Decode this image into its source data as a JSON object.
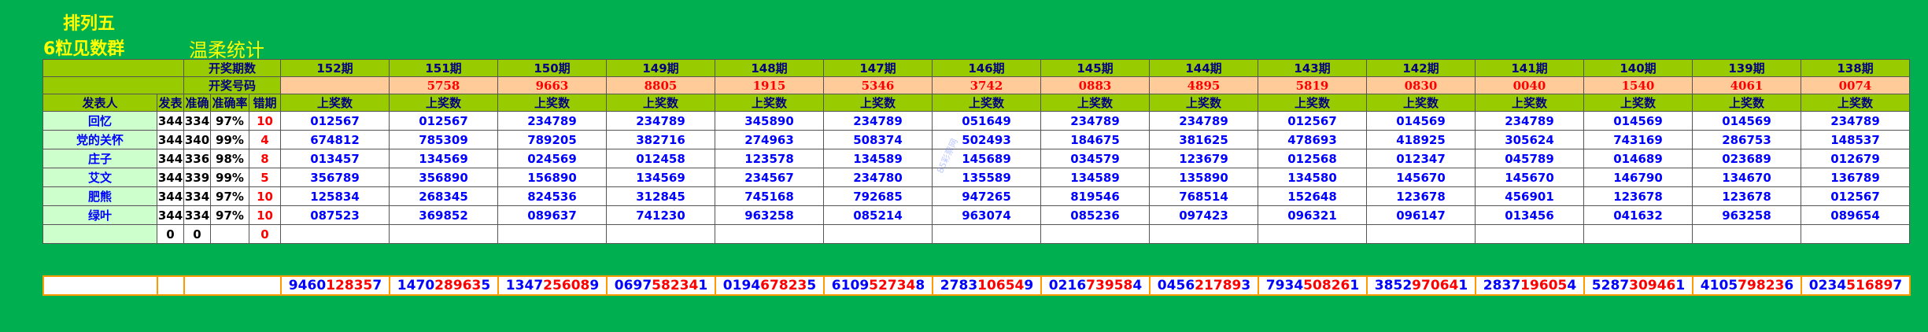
{
  "title1": "排列五",
  "title2": "6粒见数群",
  "title3": "温柔统计",
  "header": {
    "kj_qishu": "开奖期数",
    "kj_haoma": "开奖号码",
    "col_publisher": "发表人",
    "col_fa": "发表",
    "col_zhun": "准确",
    "col_rate": "准确率",
    "col_err": "错期",
    "sub_label": "上奖数"
  },
  "periods": [
    "152期",
    "151期",
    "150期",
    "149期",
    "148期",
    "147期",
    "146期",
    "145期",
    "144期",
    "143期",
    "142期",
    "141期",
    "140期",
    "139期",
    "138期"
  ],
  "draw_numbers": [
    "",
    "5758",
    "9663",
    "8805",
    "1915",
    "5346",
    "3742",
    "0883",
    "4895",
    "5819",
    "0830",
    "0040",
    "1540",
    "4061",
    "0074"
  ],
  "rows": [
    {
      "name": "回忆",
      "fa": "344",
      "zhun": "334",
      "rate": "97%",
      "err": "10",
      "nums": [
        "012567",
        "012567",
        "234789",
        "234789",
        "345890",
        "234789",
        "051649",
        "234789",
        "234789",
        "012567",
        "014569",
        "234789",
        "014569",
        "014569",
        "234789"
      ]
    },
    {
      "name": "党的关怀",
      "fa": "344",
      "zhun": "340",
      "rate": "99%",
      "err": "4",
      "nums": [
        "674812",
        "785309",
        "789205",
        "382716",
        "274963",
        "508374",
        "502493",
        "184675",
        "381625",
        "478693",
        "418925",
        "305624",
        "743169",
        "286753",
        "148537"
      ]
    },
    {
      "name": "庄子",
      "fa": "344",
      "zhun": "336",
      "rate": "98%",
      "err": "8",
      "nums": [
        "013457",
        "134569",
        "024569",
        "012458",
        "123578",
        "134589",
        "145689",
        "034579",
        "123679",
        "012568",
        "012347",
        "045789",
        "014689",
        "023689",
        "012679"
      ]
    },
    {
      "name": "艾文",
      "fa": "344",
      "zhun": "339",
      "rate": "99%",
      "err": "5",
      "nums": [
        "356789",
        "356890",
        "156890",
        "134569",
        "234567",
        "234780",
        "135589",
        "134589",
        "135890",
        "134580",
        "145670",
        "145670",
        "146790",
        "134670",
        "136789"
      ]
    },
    {
      "name": "肥熊",
      "fa": "344",
      "zhun": "334",
      "rate": "97%",
      "err": "10",
      "nums": [
        "125834",
        "268345",
        "824536",
        "312845",
        "745168",
        "792685",
        "947265",
        "819546",
        "768514",
        "152648",
        "123678",
        "456901",
        "123678",
        "123678",
        "012567"
      ]
    },
    {
      "name": "绿叶",
      "fa": "344",
      "zhun": "334",
      "rate": "97%",
      "err": "10",
      "nums": [
        "087523",
        "369852",
        "089637",
        "741230",
        "963258",
        "085214",
        "963074",
        "085236",
        "097423",
        "096321",
        "096147",
        "013456",
        "041632",
        "963258",
        "089654"
      ]
    }
  ],
  "empty_row": {
    "fa": "0",
    "zhun": "0",
    "err": "0"
  },
  "summary": [
    "9460128357",
    "1470289635",
    "1347256089",
    "0697582341",
    "0194678235",
    "6109527348",
    "2783106549",
    "0216739584",
    "0456217893",
    "7934508261",
    "3852970641",
    "2837196054",
    "5287309461",
    "4105798236",
    "0234516897"
  ],
  "watermark": "85彩票网"
}
